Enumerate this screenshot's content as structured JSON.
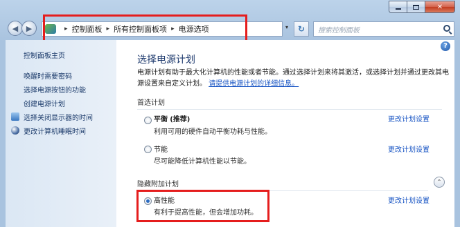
{
  "window": {
    "close_label": "✕"
  },
  "nav": {
    "back_label": "◀",
    "forward_label": "▶",
    "breadcrumb": [
      "控制面板",
      "所有控制面板项",
      "电源选项"
    ],
    "separator": "▸",
    "dropdown_label": "▾",
    "search_placeholder": "搜索控制面板"
  },
  "sidebar": {
    "home": "控制面板主页",
    "items": [
      {
        "label": "唤醒时需要密码",
        "icon": "none"
      },
      {
        "label": "选择电源按钮的功能",
        "icon": "none"
      },
      {
        "label": "创建电源计划",
        "icon": "none"
      },
      {
        "label": "选择关闭显示器的时间",
        "icon": "monitor-icon"
      },
      {
        "label": "更改计算机睡眠时间",
        "icon": "moon-icon"
      }
    ]
  },
  "main": {
    "help_label": "?",
    "title": "选择电源计划",
    "description": "电源计划有助于最大化计算机的性能或者节能。通过选择计划来将其激活，或选择计划并通过更改其电源设置来自定义计划。",
    "description_link": "请提供电源计划的详细信息。",
    "preferred_label": "首选计划",
    "hidden_label": "隐藏附加计划",
    "collapse_label": "⌃",
    "change_link": "更改计划设置",
    "plans": [
      {
        "name": "平衡",
        "tag": "(推荐)",
        "desc": "利用可用的硬件自动平衡功耗与性能。",
        "selected": false
      },
      {
        "name": "节能",
        "tag": "",
        "desc": "尽可能降低计算机性能以节能。",
        "selected": false
      },
      {
        "name": "高性能",
        "tag": "",
        "desc": "有利于提高性能，但会增加功耗。",
        "selected": true
      }
    ]
  },
  "colors": {
    "highlight_box": "#e51d1d",
    "link": "#1a56c4",
    "title": "#1e3a6e"
  }
}
